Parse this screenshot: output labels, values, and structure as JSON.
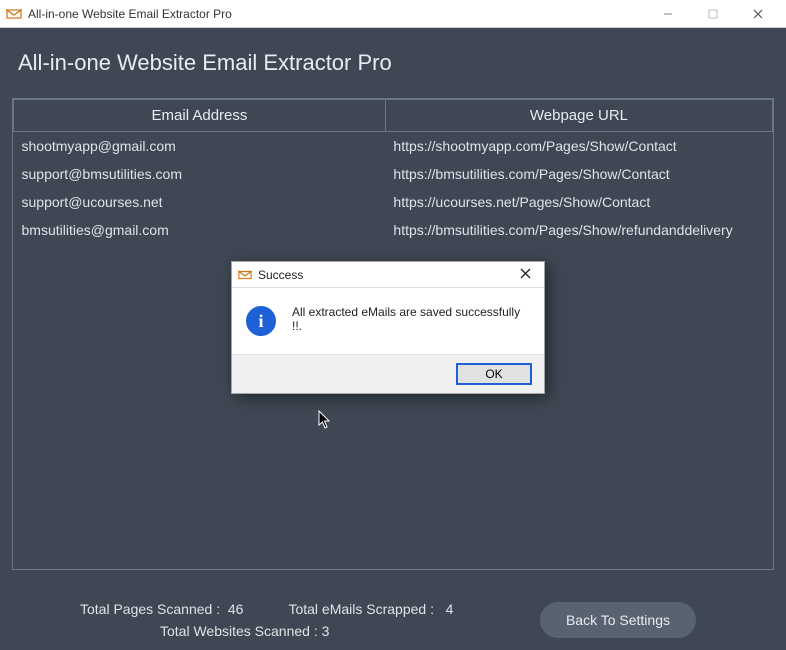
{
  "window": {
    "title": "All-in-one Website Email Extractor Pro"
  },
  "header": {
    "title": "All-in-one Website Email Extractor Pro"
  },
  "table": {
    "columns": [
      "Email Address",
      "Webpage URL"
    ],
    "rows": [
      {
        "email": "shootmyapp@gmail.com",
        "url": "https://shootmyapp.com/Pages/Show/Contact"
      },
      {
        "email": "support@bmsutilities.com",
        "url": "https://bmsutilities.com/Pages/Show/Contact"
      },
      {
        "email": "support@ucourses.net",
        "url": "https://ucourses.net/Pages/Show/Contact"
      },
      {
        "email": "bmsutilities@gmail.com",
        "url": "https://bmsutilities.com/Pages/Show/refundanddelivery"
      }
    ]
  },
  "footer": {
    "pages_label": "Total Pages Scanned  :",
    "pages_value": "46",
    "emails_label": "Total eMails Scrapped :",
    "emails_value": "4",
    "websites_label": "Total Websites Scanned  :",
    "websites_value": "3",
    "back_button": "Back To Settings"
  },
  "dialog": {
    "title": "Success",
    "message": "All extracted eMails are saved successfully !!.",
    "ok": "OK"
  }
}
